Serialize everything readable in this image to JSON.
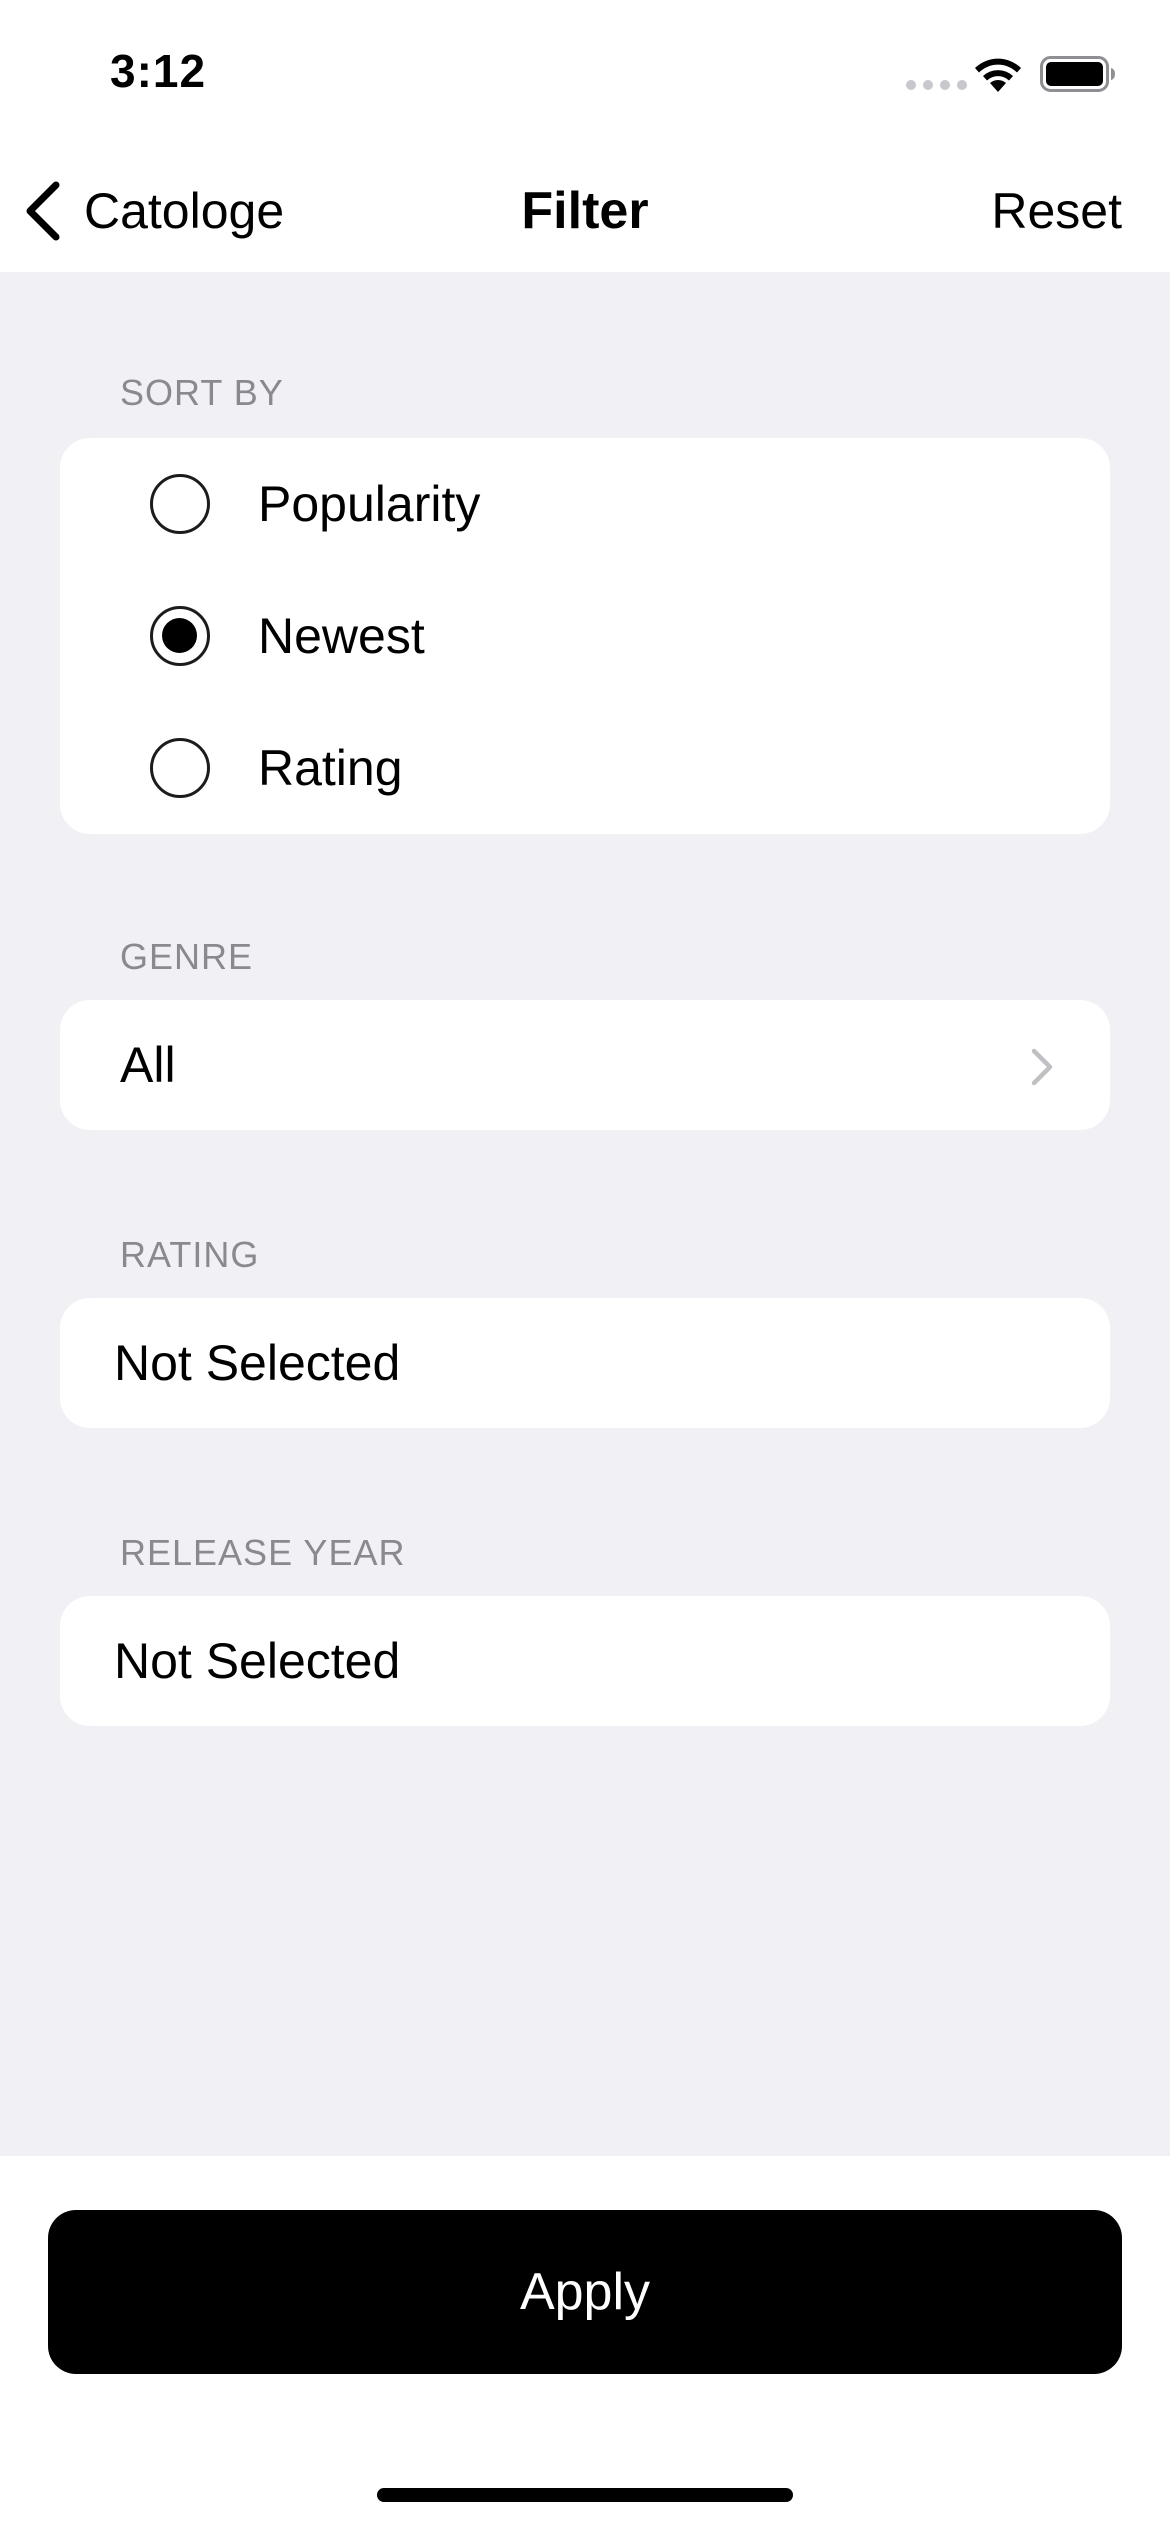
{
  "status_bar": {
    "time": "3:12"
  },
  "nav": {
    "back_label": "Catologe",
    "title": "Filter",
    "reset_label": "Reset"
  },
  "sort_by": {
    "label": "SORT BY",
    "options": [
      {
        "label": "Popularity",
        "selected": false
      },
      {
        "label": "Newest",
        "selected": true
      },
      {
        "label": "Rating",
        "selected": false
      }
    ]
  },
  "genre": {
    "label": "GENRE",
    "value": "All"
  },
  "rating": {
    "label": "RATING",
    "value": "Not Selected"
  },
  "release_year": {
    "label": "RELEASE YEAR",
    "value": "Not Selected"
  },
  "apply_label": "Apply",
  "colors": {
    "background": "#f1f1f5",
    "card": "#ffffff",
    "section_label": "#8a8a8e",
    "primary": "#000000",
    "chevron": "#c0c0c4"
  }
}
